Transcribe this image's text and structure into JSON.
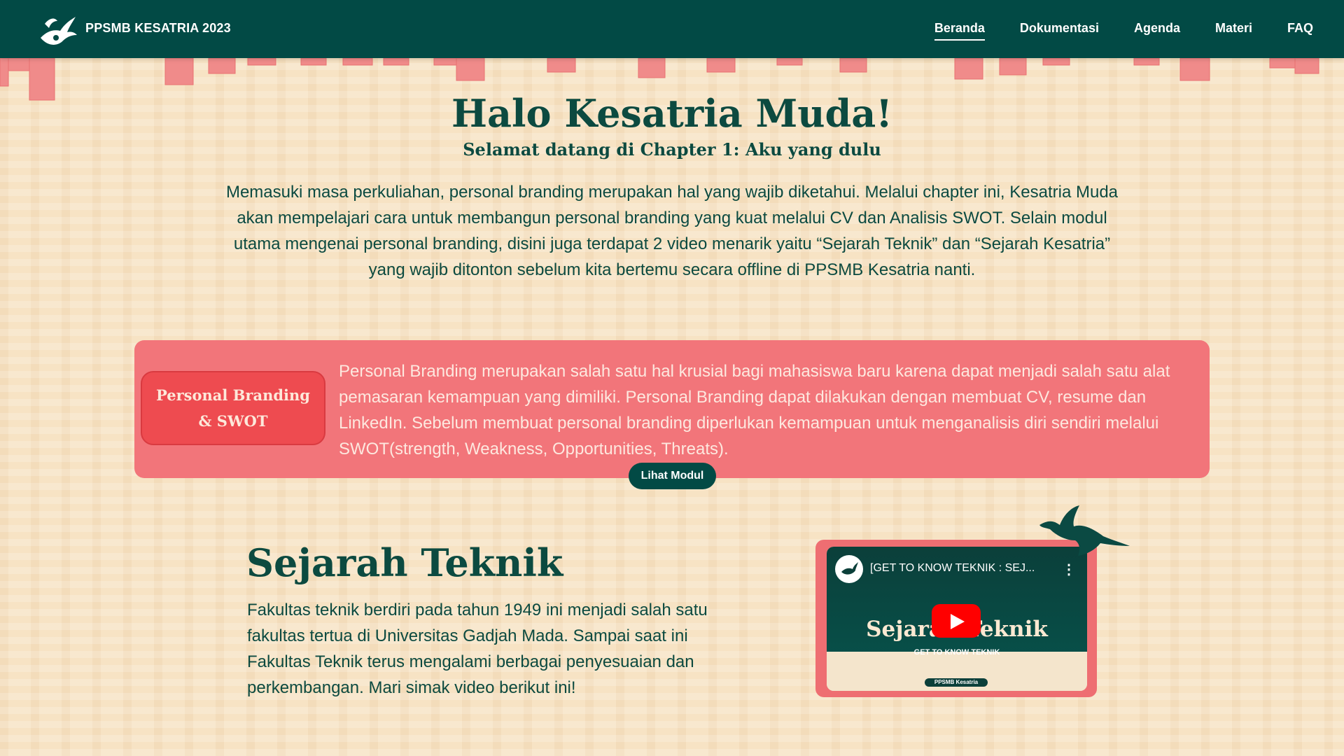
{
  "navbar": {
    "brand": "PPSMB KESATRIA 2023",
    "items": [
      {
        "label": "Beranda",
        "active": true
      },
      {
        "label": "Dokumentasi"
      },
      {
        "label": "Agenda"
      },
      {
        "label": "Materi"
      },
      {
        "label": "FAQ"
      }
    ]
  },
  "hero": {
    "title": "Halo Kesatria Muda!",
    "subtitle": "Selamat datang di Chapter 1: Aku yang dulu",
    "text": "Memasuki masa perkuliahan, personal branding merupakan hal yang wajib diketahui. Melalui chapter ini, Kesatria Muda akan mempelajari cara untuk membangun personal branding yang kuat melalui CV dan Analisis SWOT. Selain modul utama mengenai personal branding, disini juga terdapat 2 video menarik yaitu “Sejarah Teknik” dan “Sejarah Kesatria” yang wajib ditonton sebelum kita bertemu secara offline di PPSMB Kesatria nanti."
  },
  "module": {
    "label": "Personal Branding & SWOT",
    "description": "Personal Branding merupakan salah satu hal krusial bagi mahasiswa baru karena dapat menjadi salah satu alat pemasaran kemampuan yang dimiliki. Personal Branding dapat dilakukan dengan membuat CV, resume dan LinkedIn. Sebelum membuat personal branding diperlukan kemampuan untuk menganalisis diri sendiri melalui SWOT(strength, Weakness, Opportunities, Threats).",
    "button": "Lihat Modul"
  },
  "section": {
    "title": "Sejarah Teknik",
    "text": "Fakultas teknik berdiri pada tahun 1949 ini menjadi salah satu fakultas tertua di Universitas Gadjah Mada. Sampai saat ini Fakultas Teknik terus mengalami berbagai penyesuaian dan perkembangan. Mari simak video berikut ini!"
  },
  "video": {
    "title": "[GET TO KNOW TEKNIK : SEJ...",
    "menu": "⋮",
    "thumb_title": "Sejarah Teknik",
    "thumb_sub": "GET TO KNOW TEKNIK",
    "badge": "PPSMB Kesatria"
  },
  "icons": [
    "garuda-logo-icon",
    "youtube-play-icon",
    "kebab-menu-icon",
    "bird-icon"
  ],
  "colors": {
    "nav": "#024a45",
    "background": "#f7e3c4",
    "text": "#0c4a40",
    "card": "#f2757a",
    "card_label": "#ee4b50",
    "button": "#024a45"
  }
}
